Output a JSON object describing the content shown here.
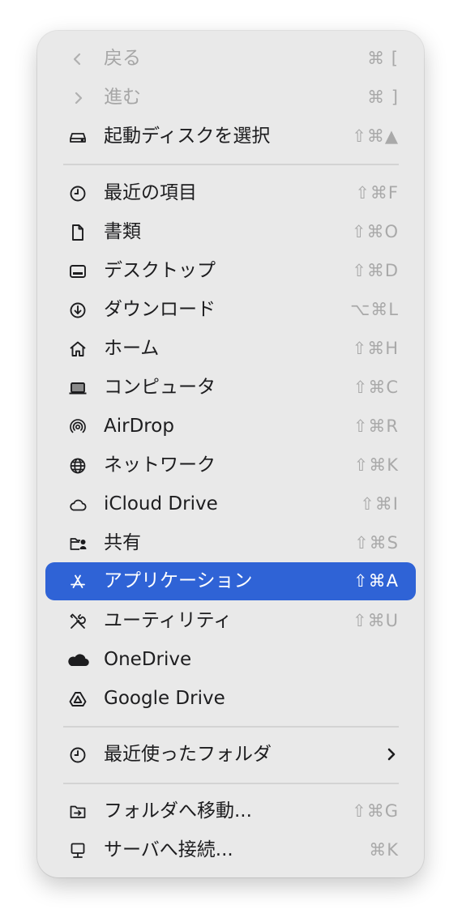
{
  "menu": {
    "back": {
      "label": "戻る",
      "shortcut": "⌘ [",
      "icon": "chevron-left-icon"
    },
    "forward": {
      "label": "進む",
      "shortcut": "⌘ ]",
      "icon": "chevron-right-icon"
    },
    "startup_disk": {
      "label": "起動ディスクを選択",
      "shortcut": "⇧⌘▲",
      "icon": "drive-icon"
    },
    "recents": {
      "label": "最近の項目",
      "shortcut": "⇧⌘F",
      "icon": "clock-icon"
    },
    "documents": {
      "label": "書類",
      "shortcut": "⇧⌘O",
      "icon": "document-icon"
    },
    "desktop": {
      "label": "デスクトップ",
      "shortcut": "⇧⌘D",
      "icon": "desktop-icon"
    },
    "downloads": {
      "label": "ダウンロード",
      "shortcut": "⌥⌘L",
      "icon": "download-icon"
    },
    "home": {
      "label": "ホーム",
      "shortcut": "⇧⌘H",
      "icon": "house-icon"
    },
    "computer": {
      "label": "コンピュータ",
      "shortcut": "⇧⌘C",
      "icon": "laptop-icon"
    },
    "airdrop": {
      "label": "AirDrop",
      "shortcut": "⇧⌘R",
      "icon": "airdrop-icon"
    },
    "network": {
      "label": "ネットワーク",
      "shortcut": "⇧⌘K",
      "icon": "globe-icon"
    },
    "icloud": {
      "label": "iCloud Drive",
      "shortcut": "⇧⌘I",
      "icon": "cloud-icon"
    },
    "shared": {
      "label": "共有",
      "shortcut": "⇧⌘S",
      "icon": "shared-folder-icon"
    },
    "applications": {
      "label": "アプリケーション",
      "shortcut": "⇧⌘A",
      "icon": "app-store-icon"
    },
    "utilities": {
      "label": "ユーティリティ",
      "shortcut": "⇧⌘U",
      "icon": "tools-icon"
    },
    "onedrive": {
      "label": "OneDrive",
      "icon": "onedrive-icon"
    },
    "google_drive": {
      "label": "Google Drive",
      "icon": "google-drive-icon"
    },
    "recent_folders": {
      "label": "最近使ったフォルダ",
      "icon": "clock-icon"
    },
    "go_to_folder": {
      "label": "フォルダへ移動...",
      "shortcut": "⇧⌘G",
      "icon": "folder-arrow-icon"
    },
    "connect_server": {
      "label": "サーバへ接続...",
      "shortcut": "⌘K",
      "icon": "monitor-icon"
    }
  },
  "colors": {
    "menu_bg": "#e9e9e9",
    "selected_bg": "#2f63d6",
    "text": "#1d1d1f",
    "disabled_text": "#a6a6a6",
    "shortcut_text": "#a9a9a9"
  }
}
